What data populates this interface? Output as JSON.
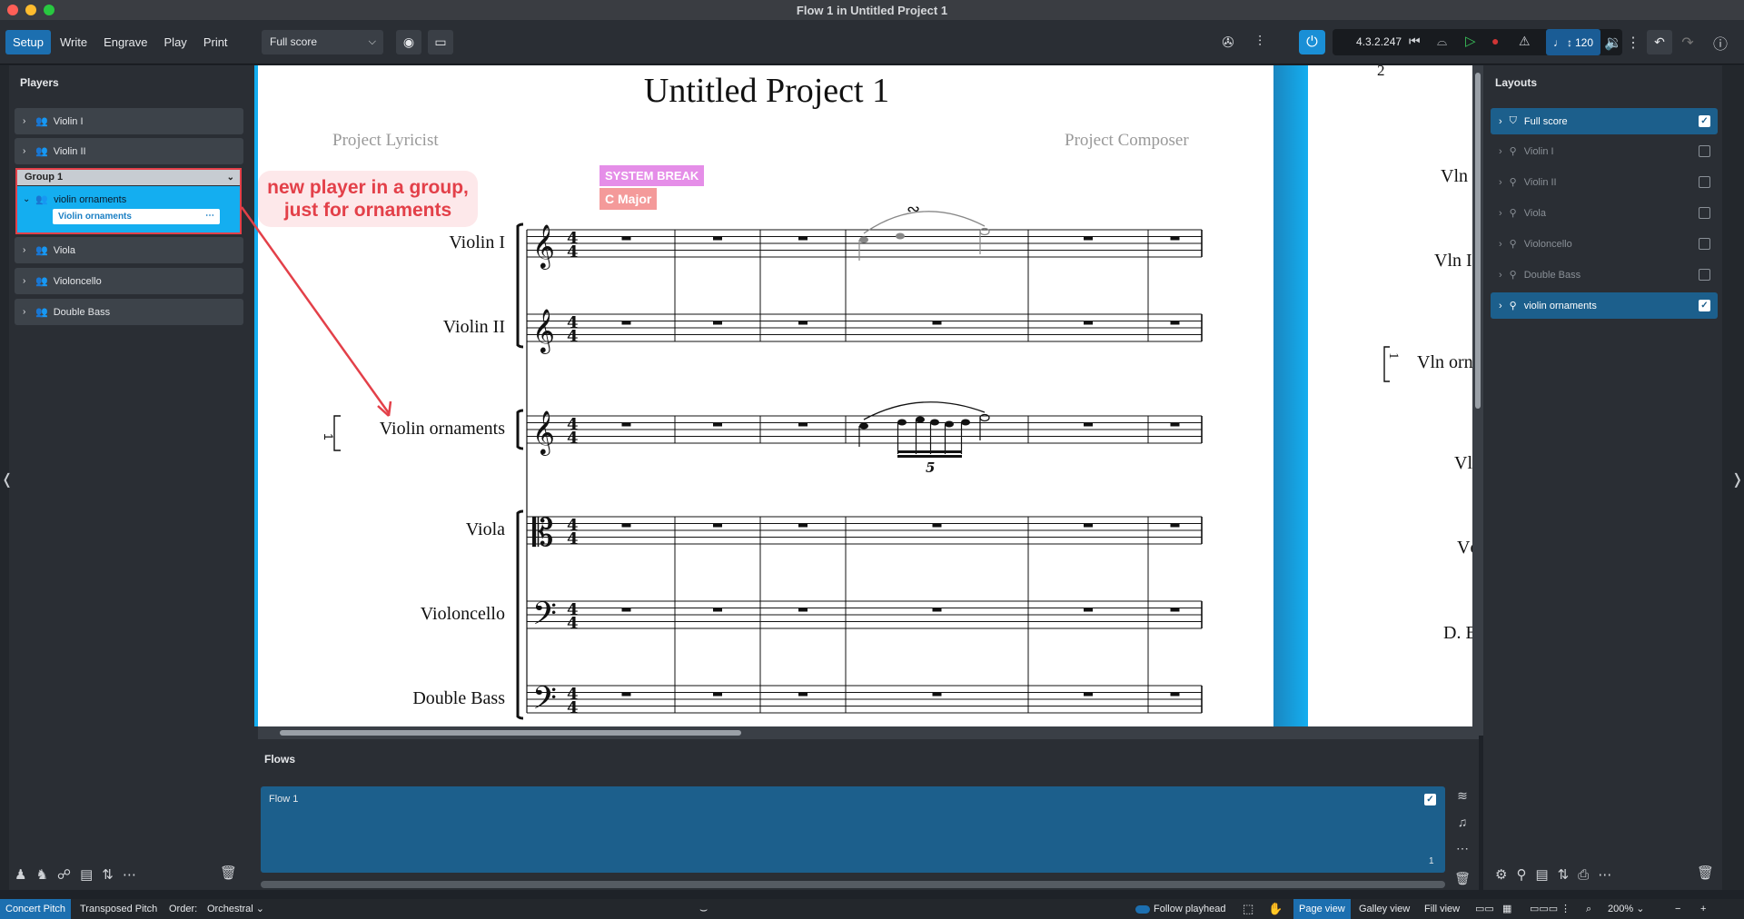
{
  "window": {
    "title": "Flow 1 in Untitled Project 1",
    "traffic_colors": [
      "#ff5f57",
      "#febc2e",
      "#28c840"
    ]
  },
  "toolbar": {
    "modes": [
      "Setup",
      "Write",
      "Engrave",
      "Play",
      "Print"
    ],
    "active_mode": "Setup",
    "layout_select": "Full score",
    "timecode": "4.3.2.247",
    "tempo": "120"
  },
  "players_panel": {
    "title": "Players",
    "players": [
      {
        "label": "Violin I"
      },
      {
        "label": "Violin II"
      }
    ],
    "group": {
      "label": "Group 1",
      "player": "violin ornaments",
      "instrument": "Violin ornaments"
    },
    "players_after": [
      {
        "label": "Viola"
      },
      {
        "label": "Violoncello"
      },
      {
        "label": "Double Bass"
      }
    ]
  },
  "annotation": {
    "line1": "new player in a group,",
    "line2": "just for ornaments",
    "color": "#e34049"
  },
  "score": {
    "title": "Untitled Project 1",
    "lyricist": "Project Lyricist",
    "composer": "Project Composer",
    "system_break": "SYSTEM BREAK",
    "key_signature": "C Major",
    "staves": [
      "Violin I",
      "Violin II",
      "Violin ornaments",
      "Viola",
      "Violoncello",
      "Double Bass"
    ],
    "time_signature": "4/4",
    "tuplet": "5",
    "group_bracket_label": "1",
    "ornament": "∾",
    "page2_number": "2",
    "page2_labels": [
      "Vln",
      "Vln I",
      "Vln orn",
      "Vl",
      "Vc",
      "D. B"
    ]
  },
  "flows": {
    "title": "Flows",
    "flow_name": "Flow 1",
    "flow_number": "1"
  },
  "layouts_panel": {
    "title": "Layouts",
    "items": [
      {
        "label": "Full score",
        "selected": true
      },
      {
        "label": "Violin I",
        "selected": false
      },
      {
        "label": "Violin II",
        "selected": false
      },
      {
        "label": "Viola",
        "selected": false
      },
      {
        "label": "Violoncello",
        "selected": false
      },
      {
        "label": "Double Bass",
        "selected": false
      },
      {
        "label": "violin ornaments",
        "selected": true
      }
    ]
  },
  "statusbar": {
    "concert_pitch": "Concert Pitch",
    "transposed_pitch": "Transposed Pitch",
    "order_label": "Order:",
    "order_value": "Orchestral",
    "follow_playhead": "Follow playhead",
    "page_view": "Page view",
    "galley_view": "Galley view",
    "fill_view": "Fill view",
    "zoom": "200%"
  },
  "colors": {
    "accent": "#1c6fb0",
    "selection": "#14aef0",
    "system_break": "#e58ee8",
    "key_sig": "#f49a9a"
  }
}
